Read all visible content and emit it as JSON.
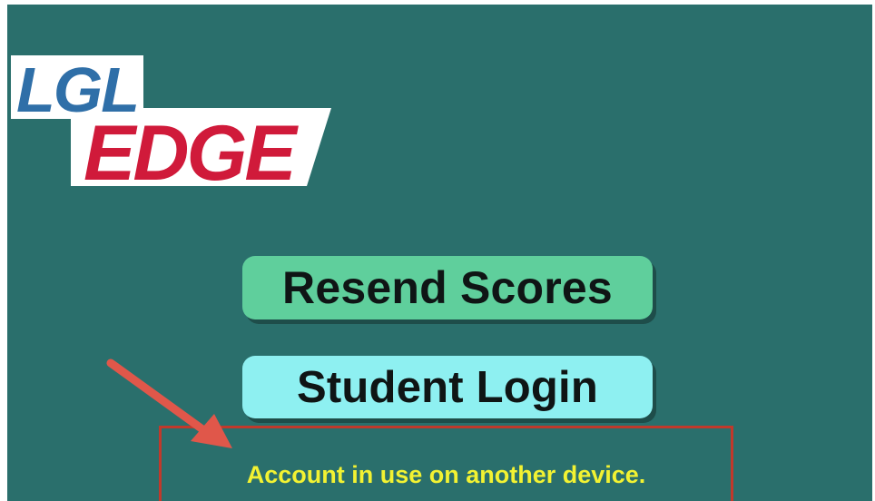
{
  "logo": {
    "top_text": "LGL",
    "bottom_text": "EDGE",
    "colors": {
      "top": "#2f6fa8",
      "bottom": "#d01a3a",
      "plate": "#ffffff"
    }
  },
  "buttons": {
    "resend_scores": "Resend Scores",
    "student_login": "Student Login"
  },
  "message": {
    "text": "Account in use on another device."
  },
  "colors": {
    "background": "#2a6f6c",
    "resend_button": "#5fcf9c",
    "login_button": "#8ef0f1",
    "message_text": "#f2f232",
    "highlight": "#c0392b",
    "arrow": "#e0574a"
  },
  "icons": {
    "annotation": "arrow-icon"
  }
}
